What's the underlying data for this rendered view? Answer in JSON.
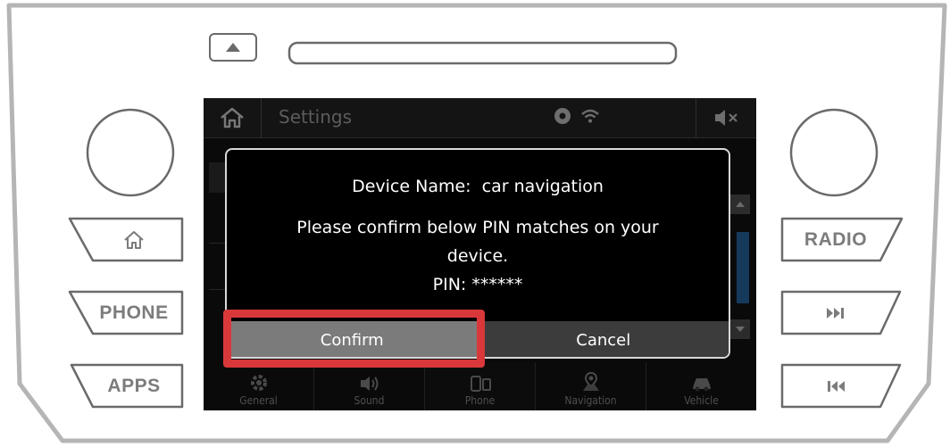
{
  "hardware": {
    "phone_label": "PHONE",
    "apps_label": "APPS",
    "radio_label": "RADIO",
    "icons": [
      "eject-icon",
      "home-icon",
      "next-track-icon",
      "previous-track-icon"
    ]
  },
  "screen": {
    "status_bar": {
      "title": "Settings",
      "icons": [
        "home-icon",
        "record-icon",
        "wifi-icon",
        "mute-icon"
      ]
    },
    "bottom_nav": [
      {
        "label": "General",
        "icon": "gear-icon"
      },
      {
        "label": "Sound",
        "icon": "speaker-icon"
      },
      {
        "label": "Phone",
        "icon": "phone-icon"
      },
      {
        "label": "Navigation",
        "icon": "map-pin-icon"
      },
      {
        "label": "Vehicle",
        "icon": "car-icon"
      }
    ],
    "dialog": {
      "device_name": "Device Name:  car navigation",
      "message_line1": "Please confirm below PIN matches on your",
      "message_line2": "device.",
      "pin": "PIN: ******",
      "confirm_label": "Confirm",
      "cancel_label": "Cancel"
    }
  },
  "colors": {
    "highlight": "#d9383a",
    "confirm_button": "#7b7b7b",
    "cancel_button": "#3c3c3c",
    "screen_bg": "#0a0a0a"
  }
}
